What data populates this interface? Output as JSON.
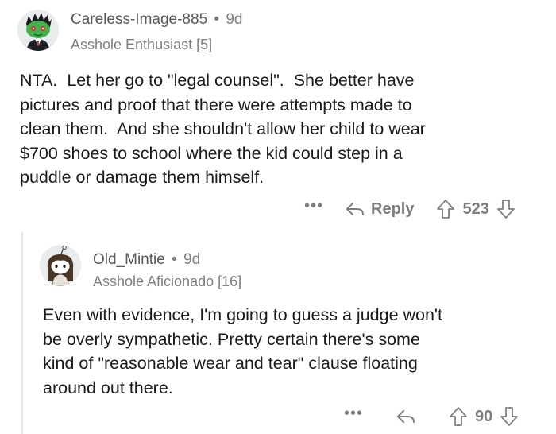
{
  "comments": [
    {
      "username": "Careless-Image-885",
      "separator": "•",
      "age": "9d",
      "flair": "Asshole Enthusiast [5]",
      "body_lines": [
        "NTA.  Let her go to \"legal counsel\".  She better have",
        "pictures and proof that there were attempts made to",
        "clean them.  And she shouldn't allow her child to wear",
        "$700 shoes to school where the kid could step in a",
        "puddle or damage them himself."
      ],
      "more_label": "•••",
      "reply_label": "Reply",
      "score": "523",
      "avatar_icon": "green-snoo-avatar-icon"
    },
    {
      "username": "Old_Mintie",
      "separator": "•",
      "age": "9d",
      "flair": "Asshole Aficionado [16]",
      "body_lines": [
        "Even with evidence, I'm going to guess a judge won't",
        "be overly sympathetic. Pretty certain there's some",
        "kind of \"reasonable wear and tear\" clause floating",
        "around out there."
      ],
      "more_label": "•••",
      "reply_label": "",
      "score": "90",
      "avatar_icon": "girl-avatar-icon"
    }
  ],
  "colors": {
    "meta_gray": "#7c7f82",
    "text": "#1a1a1b",
    "thread_line": "#e6e7e8"
  }
}
